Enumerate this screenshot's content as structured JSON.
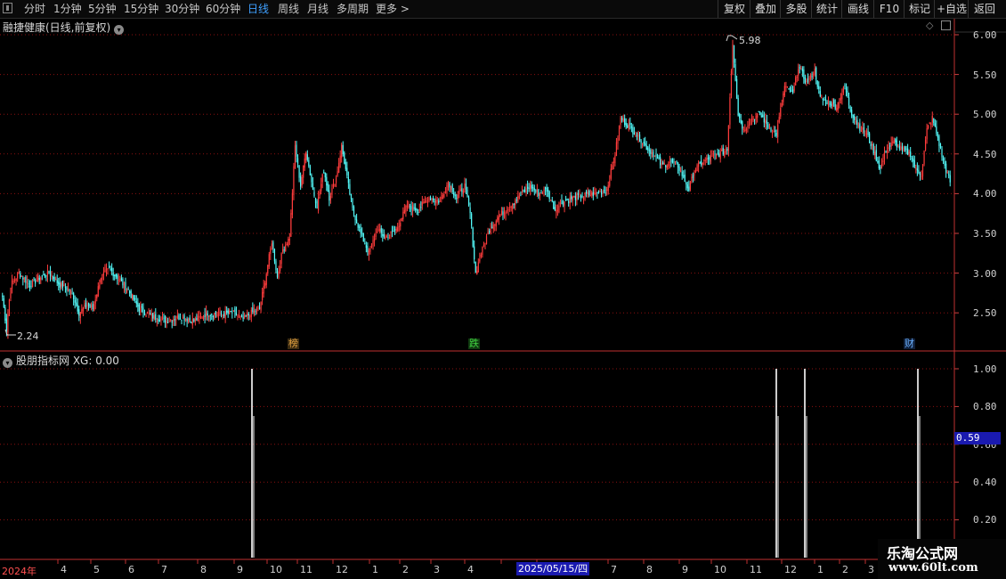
{
  "toolbar": {
    "periods": [
      "分时",
      "1分钟",
      "5分钟",
      "15分钟",
      "30分钟",
      "60分钟",
      "日线",
      "周线",
      "月线",
      "多周期",
      "更多 >"
    ],
    "active_period": "日线",
    "right_buttons": [
      "复权",
      "叠加",
      "多股",
      "统计",
      "画线",
      "F10",
      "标记",
      "+自选",
      "返回"
    ]
  },
  "main_panel": {
    "title": "融捷健康(日线,前复权)",
    "high_label": "5.98",
    "low_label": "2.24",
    "price_axis": [
      "6.00",
      "5.50",
      "5.00",
      "4.50",
      "4.00",
      "3.50",
      "3.00",
      "2.50"
    ],
    "annotations": [
      {
        "text": "榜",
        "color": "#e0a040"
      },
      {
        "text": "跌",
        "color": "#40d040"
      },
      {
        "text": "财",
        "color": "#6ab0ff"
      }
    ]
  },
  "indicator_panel": {
    "title": "股朋指标网 XG: 0.00",
    "axis": [
      "1.00",
      "0.80",
      "0.60",
      "0.40",
      "0.20"
    ],
    "current_value": "0.59"
  },
  "date_axis": {
    "year_label": "2024年",
    "months": [
      "4",
      "5",
      "6",
      "7",
      "8",
      "9",
      "10",
      "11",
      "12",
      "1",
      "2",
      "3",
      "4",
      "5",
      "6",
      "7",
      "8",
      "9",
      "10",
      "11",
      "12",
      "1",
      "2",
      "3"
    ],
    "cursor_date": "2025/05/15/四"
  },
  "watermark": {
    "line1": "乐淘公式网",
    "line2": "www.60lt.com"
  },
  "colors": {
    "up": "#ff3c3c",
    "down": "#54fcfc",
    "grid": "#8a1010",
    "active": "#3fa0ff"
  },
  "chart_data": {
    "type": "candlestick",
    "ylim": [
      2.2,
      6.05
    ],
    "indicator_ylim": [
      0,
      1
    ],
    "close_anchors": [
      [
        0,
        2.7
      ],
      [
        3,
        2.3
      ],
      [
        6,
        2.85
      ],
      [
        12,
        3.0
      ],
      [
        20,
        2.85
      ],
      [
        28,
        2.95
      ],
      [
        34,
        3.0
      ],
      [
        42,
        2.85
      ],
      [
        48,
        2.8
      ],
      [
        52,
        2.7
      ],
      [
        56,
        2.5
      ],
      [
        62,
        2.6
      ],
      [
        66,
        2.55
      ],
      [
        72,
        2.95
      ],
      [
        78,
        3.05
      ],
      [
        84,
        2.95
      ],
      [
        92,
        2.78
      ],
      [
        100,
        2.55
      ],
      [
        110,
        2.45
      ],
      [
        120,
        2.4
      ],
      [
        130,
        2.45
      ],
      [
        140,
        2.4
      ],
      [
        150,
        2.5
      ],
      [
        160,
        2.48
      ],
      [
        168,
        2.5
      ],
      [
        176,
        2.42
      ],
      [
        182,
        2.5
      ],
      [
        188,
        2.55
      ],
      [
        193,
        3.0
      ],
      [
        197,
        3.4
      ],
      [
        201,
        2.95
      ],
      [
        205,
        3.3
      ],
      [
        210,
        3.45
      ],
      [
        214,
        4.6
      ],
      [
        218,
        4.1
      ],
      [
        222,
        4.55
      ],
      [
        227,
        4.05
      ],
      [
        230,
        3.85
      ],
      [
        235,
        4.3
      ],
      [
        239,
        3.95
      ],
      [
        244,
        4.2
      ],
      [
        248,
        4.6
      ],
      [
        252,
        4.2
      ],
      [
        256,
        3.8
      ],
      [
        262,
        3.5
      ],
      [
        268,
        3.25
      ],
      [
        274,
        3.55
      ],
      [
        280,
        3.45
      ],
      [
        288,
        3.55
      ],
      [
        296,
        3.85
      ],
      [
        304,
        3.8
      ],
      [
        312,
        3.95
      ],
      [
        320,
        3.9
      ],
      [
        326,
        4.15
      ],
      [
        332,
        3.95
      ],
      [
        338,
        4.1
      ],
      [
        342,
        3.75
      ],
      [
        346,
        3.0
      ],
      [
        350,
        3.25
      ],
      [
        356,
        3.55
      ],
      [
        362,
        3.7
      ],
      [
        368,
        3.8
      ],
      [
        374,
        3.9
      ],
      [
        380,
        4.0
      ],
      [
        386,
        4.1
      ],
      [
        392,
        4.0
      ],
      [
        398,
        4.05
      ],
      [
        404,
        3.8
      ],
      [
        410,
        3.9
      ],
      [
        418,
        3.95
      ],
      [
        426,
        3.98
      ],
      [
        434,
        4.0
      ],
      [
        442,
        4.05
      ],
      [
        448,
        4.5
      ],
      [
        452,
        4.95
      ],
      [
        458,
        4.85
      ],
      [
        464,
        4.75
      ],
      [
        470,
        4.6
      ],
      [
        476,
        4.5
      ],
      [
        482,
        4.35
      ],
      [
        488,
        4.4
      ],
      [
        494,
        4.35
      ],
      [
        498,
        4.2
      ],
      [
        502,
        4.05
      ],
      [
        506,
        4.3
      ],
      [
        512,
        4.4
      ],
      [
        518,
        4.45
      ],
      [
        524,
        4.5
      ],
      [
        530,
        4.55
      ],
      [
        534,
        5.9
      ],
      [
        538,
        5.0
      ],
      [
        542,
        4.8
      ],
      [
        548,
        4.95
      ],
      [
        554,
        5.0
      ],
      [
        560,
        4.85
      ],
      [
        566,
        4.75
      ],
      [
        572,
        5.35
      ],
      [
        578,
        5.25
      ],
      [
        582,
        5.6
      ],
      [
        588,
        5.4
      ],
      [
        594,
        5.55
      ],
      [
        598,
        5.2
      ],
      [
        604,
        5.15
      ],
      [
        610,
        5.1
      ],
      [
        616,
        5.35
      ],
      [
        620,
        5.05
      ],
      [
        626,
        4.85
      ],
      [
        632,
        4.75
      ],
      [
        638,
        4.5
      ],
      [
        642,
        4.3
      ],
      [
        646,
        4.55
      ],
      [
        652,
        4.65
      ],
      [
        658,
        4.55
      ],
      [
        664,
        4.5
      ],
      [
        668,
        4.3
      ],
      [
        672,
        4.25
      ],
      [
        676,
        4.8
      ],
      [
        680,
        4.95
      ],
      [
        684,
        4.7
      ],
      [
        688,
        4.4
      ],
      [
        693,
        4.15
      ]
    ],
    "extremes": [
      {
        "label": "5.98",
        "value": 5.98
      },
      {
        "label": "2.24",
        "value": 2.24
      }
    ],
    "signals": [
      {
        "month_between": [
          "9",
          "10"
        ],
        "value": 1.0
      },
      {
        "month_between": [
          "12",
          "1"
        ],
        "value": 1.0
      },
      {
        "month_between": [
          "1",
          "2"
        ],
        "value": 1.0
      },
      {
        "month_between": [
          "2",
          "3"
        ],
        "value": 1.0
      }
    ]
  }
}
